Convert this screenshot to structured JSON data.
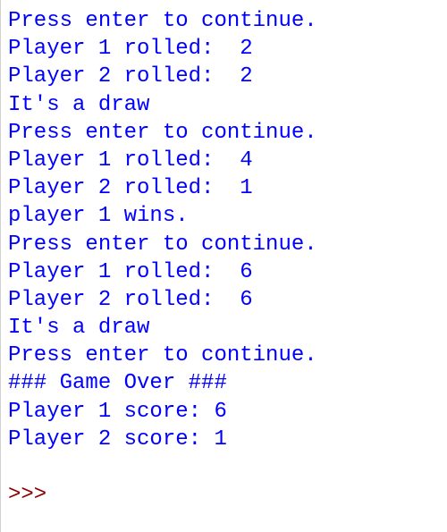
{
  "console": {
    "lines": [
      "Press enter to continue.",
      "Player 1 rolled:  2",
      "Player 2 rolled:  2",
      "It's a draw",
      "Press enter to continue.",
      "Player 1 rolled:  4",
      "Player 2 rolled:  1",
      "player 1 wins.",
      "Press enter to continue.",
      "Player 1 rolled:  6",
      "Player 2 rolled:  6",
      "It's a draw",
      "Press enter to continue.",
      "### Game Over ###",
      "Player 1 score: 6",
      "Player 2 score: 1"
    ],
    "prompt": ">>> "
  }
}
